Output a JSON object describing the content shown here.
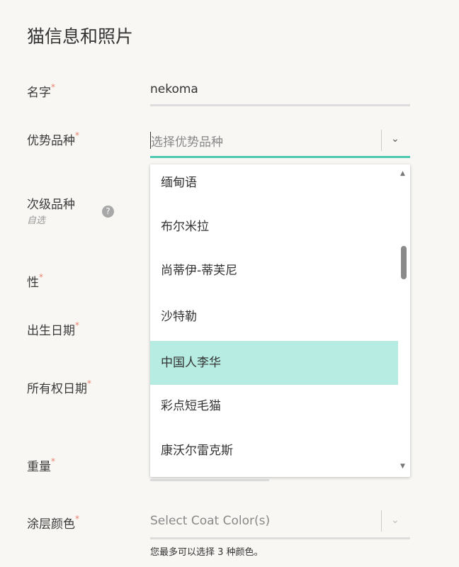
{
  "title": "猫信息和照片",
  "required_mark": "*",
  "fields": {
    "name": {
      "label": "名字",
      "value": "nekoma"
    },
    "dominant_breed": {
      "label": "优势品种",
      "placeholder": "选择优势品种"
    },
    "secondary_breed": {
      "label": "次级品种",
      "optional": "自选",
      "help": "?"
    },
    "sex": {
      "label": "性"
    },
    "birth_date": {
      "label": "出生日期"
    },
    "ownership_date": {
      "label": "所有权日期"
    },
    "weight": {
      "label": "重量"
    },
    "coat_color": {
      "label": "涂层颜色",
      "placeholder": "Select Coat Color(s)",
      "hint": "您最多可以选择 3 种颜色。"
    }
  },
  "dropdown": {
    "items": [
      "缅甸语",
      "布尔米拉",
      "尚蒂伊-蒂芙尼",
      "沙特勒",
      "中国人李华",
      "彩点短毛猫",
      "康沃尔雷克斯"
    ],
    "highlighted_index": 4,
    "highlight_color": "#b7ece3",
    "accent_color": "#4cc9b0"
  }
}
